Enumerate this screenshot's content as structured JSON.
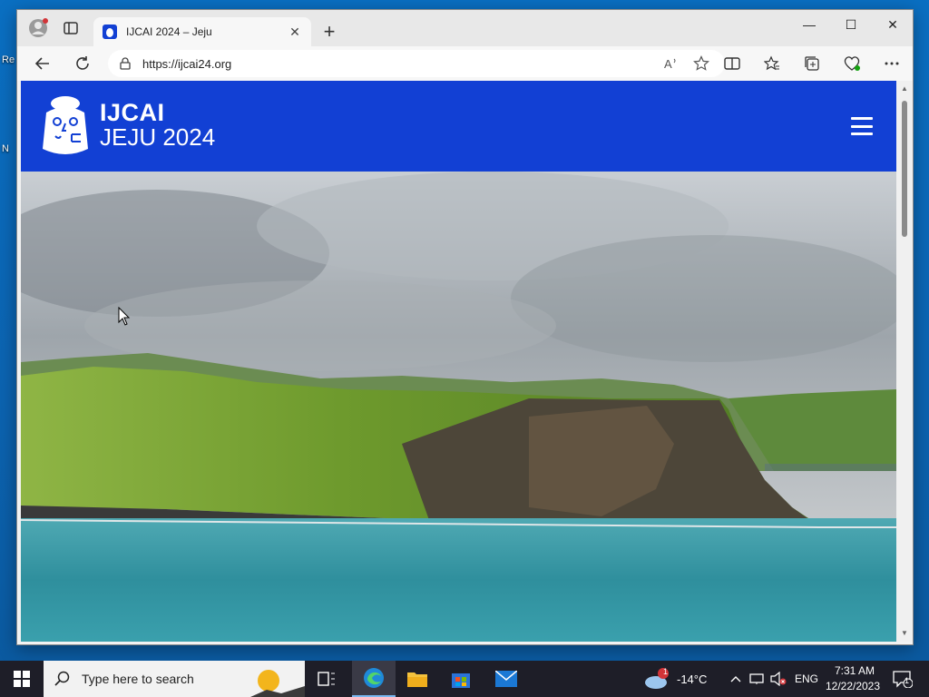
{
  "desktop": {
    "icon_labels": [
      "Re",
      "N"
    ]
  },
  "browser": {
    "tab": {
      "title": "IJCAI 2024 – Jeju",
      "close_label": "✕"
    },
    "newtab_label": "+",
    "window_controls": {
      "minimize": "—",
      "maximize": "☐",
      "close": "✕"
    },
    "address": {
      "url": "https://ijcai24.org"
    },
    "icons": {
      "back": "back-arrow-icon",
      "refresh": "refresh-icon",
      "read_aloud": "read-aloud-icon",
      "favorite": "star-icon",
      "split": "split-screen-icon",
      "favorites": "favorites-icon",
      "collections": "collections-icon",
      "health": "browser-essentials-icon",
      "menu": "more-icon"
    }
  },
  "site": {
    "logo_line1": "IJCAI",
    "logo_line2": "JEJU 2024",
    "brand_color": "#1240d4"
  },
  "taskbar": {
    "search_placeholder": "Type here to search",
    "weather_badge": "1",
    "temperature": "-14°C",
    "language": "ENG",
    "time": "7:31 AM",
    "date": "12/22/2023",
    "notification_count": "1"
  }
}
